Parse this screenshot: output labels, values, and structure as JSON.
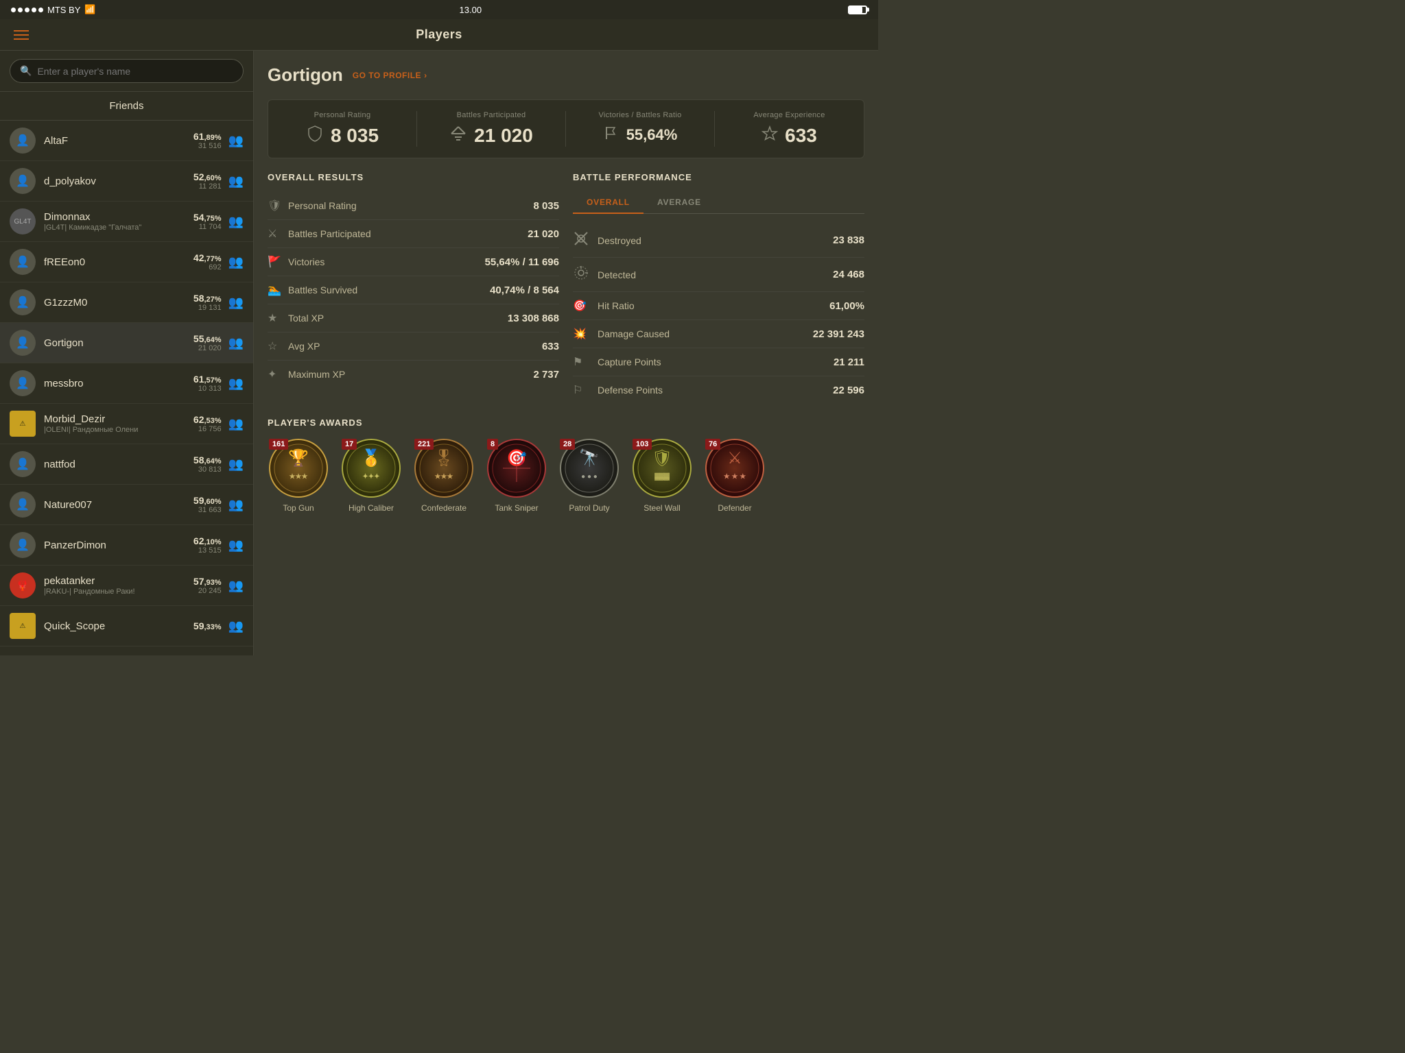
{
  "status": {
    "carrier": "MTS BY",
    "time": "13.00",
    "signal_dots": 5
  },
  "nav": {
    "title": "Players",
    "menu_label": "menu"
  },
  "search": {
    "placeholder": "Enter a player's name"
  },
  "sidebar": {
    "friends_label": "Friends",
    "items": [
      {
        "name": "AltaF",
        "winrate": "61",
        "winrate_dec": "89",
        "battles": "31 516",
        "subtitle": "",
        "avatar_type": "default"
      },
      {
        "name": "d_polyakov",
        "winrate": "52",
        "winrate_dec": "60",
        "battles": "11 281",
        "subtitle": "",
        "avatar_type": "default"
      },
      {
        "name": "Dimonnax",
        "winrate": "54",
        "winrate_dec": "75",
        "battles": "11 704",
        "subtitle": "|GL4T| Камикадзе \"Галчата\"",
        "avatar_type": "clan"
      },
      {
        "name": "fREEon0",
        "winrate": "42",
        "winrate_dec": "77",
        "battles": "692",
        "subtitle": "",
        "avatar_type": "default"
      },
      {
        "name": "G1zzzM0",
        "winrate": "58",
        "winrate_dec": "27",
        "battles": "19 131",
        "subtitle": "",
        "avatar_type": "default"
      },
      {
        "name": "Gortigon",
        "winrate": "55",
        "winrate_dec": "64",
        "battles": "21 020",
        "subtitle": "",
        "avatar_type": "default",
        "active": true
      },
      {
        "name": "messbro",
        "winrate": "61",
        "winrate_dec": "57",
        "battles": "10 313",
        "subtitle": "",
        "avatar_type": "default"
      },
      {
        "name": "Morbid_Dezir",
        "winrate": "62",
        "winrate_dec": "53",
        "battles": "16 756",
        "subtitle": "|OLENI| Рандомные Олени",
        "avatar_type": "special_morbid"
      },
      {
        "name": "nattfod",
        "winrate": "58",
        "winrate_dec": "64",
        "battles": "30 813",
        "subtitle": "",
        "avatar_type": "default"
      },
      {
        "name": "Nature007",
        "winrate": "59",
        "winrate_dec": "60",
        "battles": "31 663",
        "subtitle": "",
        "avatar_type": "default"
      },
      {
        "name": "PanzerDimon",
        "winrate": "62",
        "winrate_dec": "10",
        "battles": "13 515",
        "subtitle": "",
        "avatar_type": "default"
      },
      {
        "name": "pekatanker",
        "winrate": "57",
        "winrate_dec": "93",
        "battles": "20 245",
        "subtitle": "|RAKU-| Рандомные Раки!",
        "avatar_type": "special_peka"
      },
      {
        "name": "Quick_Scope",
        "winrate": "59",
        "winrate_dec": "33",
        "battles": "",
        "subtitle": "",
        "avatar_type": "special_quick"
      }
    ]
  },
  "player": {
    "name": "Gortigon",
    "go_to_profile": "GO TO PROFILE",
    "stats": {
      "personal_rating_label": "Personal Rating",
      "battles_participated_label": "Battles Participated",
      "victories_ratio_label": "Victories / Battles Ratio",
      "avg_experience_label": "Average Experience",
      "personal_rating": "8 035",
      "battles_participated": "21 020",
      "victories_ratio": "55,64%",
      "avg_experience": "633"
    },
    "overall_results": {
      "title": "OVERALL RESULTS",
      "rows": [
        {
          "label": "Personal Rating",
          "value": "8 035",
          "icon": "🛡"
        },
        {
          "label": "Battles Participated",
          "value": "21 020",
          "icon": "⚔"
        },
        {
          "label": "Victories",
          "value": "55,64% / 11 696",
          "icon": "🚩"
        },
        {
          "label": "Battles Survived",
          "value": "40,74% / 8 564",
          "icon": "🏊"
        },
        {
          "label": "Total XP",
          "value": "13 308 868",
          "icon": "★"
        },
        {
          "label": "Avg XP",
          "value": "633",
          "icon": "☆"
        },
        {
          "label": "Maximum XP",
          "value": "2 737",
          "icon": "✦"
        }
      ]
    },
    "battle_performance": {
      "title": "BATTLE PERFORMANCE",
      "tabs": [
        "OVERALL",
        "AVERAGE"
      ],
      "active_tab": "OVERALL",
      "rows": [
        {
          "label": "Destroyed",
          "value": "23 838",
          "icon": "⚡"
        },
        {
          "label": "Detected",
          "value": "24 468",
          "icon": "👁"
        },
        {
          "label": "Hit Ratio",
          "value": "61,00%",
          "icon": "🎯"
        },
        {
          "label": "Damage Caused",
          "value": "22 391 243",
          "icon": "💥"
        },
        {
          "label": "Capture Points",
          "value": "21 211",
          "icon": "⚑"
        },
        {
          "label": "Defense Points",
          "value": "22 596",
          "icon": "⚐"
        }
      ]
    },
    "awards": {
      "title": "PLAYER'S AWARDS",
      "items": [
        {
          "name": "Top Gun",
          "count": "161",
          "color": "#4a3a1a",
          "border": "#8a6a2a",
          "icon": "🏆"
        },
        {
          "name": "High Caliber",
          "count": "17",
          "color": "#3a3a1a",
          "border": "#7a7a2a",
          "icon": "🥇"
        },
        {
          "name": "Confederate",
          "count": "221",
          "color": "#3a2a1a",
          "border": "#7a5a2a",
          "icon": "🎖"
        },
        {
          "name": "Tank Sniper",
          "count": "8",
          "color": "#2a1a1a",
          "border": "#8a2a2a",
          "icon": "🎯"
        },
        {
          "name": "Patrol Duty",
          "count": "28",
          "color": "#2a2a2a",
          "border": "#6a6a5a",
          "icon": "🔭"
        },
        {
          "name": "Steel Wall",
          "count": "103",
          "color": "#3a3a1a",
          "border": "#8a7a3a",
          "icon": "🛡"
        },
        {
          "name": "Defender",
          "count": "76",
          "color": "#4a1a1a",
          "border": "#9a3a2a",
          "icon": "⚔"
        }
      ]
    }
  }
}
